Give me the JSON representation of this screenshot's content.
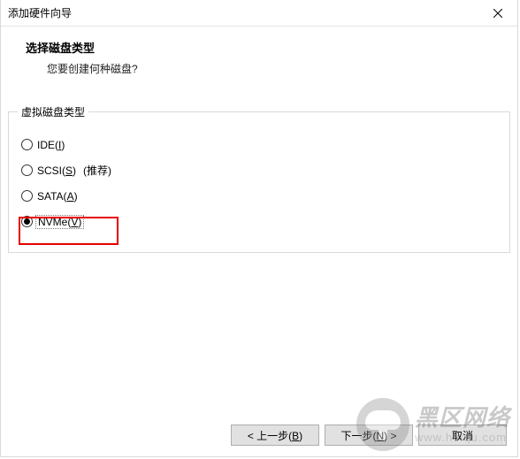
{
  "window": {
    "title": "添加硬件向导"
  },
  "header": {
    "heading": "选择磁盘类型",
    "sub": "您要创建何种磁盘?"
  },
  "group": {
    "legend": "虚拟磁盘类型",
    "options": {
      "ide": {
        "label_pre": "IDE(",
        "hotkey": "I",
        "label_post": ")",
        "selected": false
      },
      "scsi": {
        "label_pre": "SCSI(",
        "hotkey": "S",
        "label_post": ")",
        "selected": false,
        "recommended": "(推荐)"
      },
      "sata": {
        "label_pre": "SATA(",
        "hotkey": "A",
        "label_post": ")",
        "selected": false
      },
      "nvme": {
        "label_pre": "NVMe(",
        "hotkey": "V",
        "label_post": ")",
        "selected": true
      }
    }
  },
  "buttons": {
    "back_pre": "< 上一步(",
    "back_hot": "B",
    "back_post": ")",
    "next_pre": "下一步(",
    "next_hot": "N",
    "next_post": ") >",
    "cancel": "取消"
  },
  "watermark": {
    "cn": "黑区网络",
    "en": "www.heiqu.com"
  }
}
